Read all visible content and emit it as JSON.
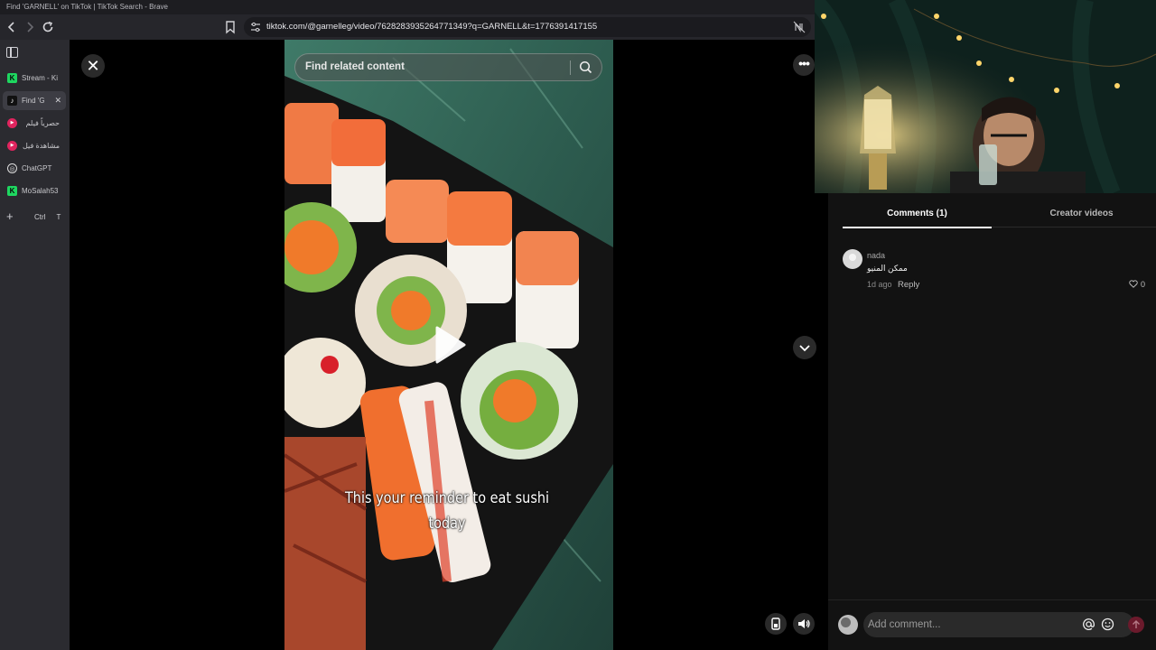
{
  "window": {
    "title": "Find 'GARNELL' on TikTok | TikTok Search - Brave"
  },
  "toolbar": {
    "url": "tiktok.com/@garnelleg/video/7628283935264771349?q=GARNELL&t=1776391417155",
    "back_icon": "arrow-left-icon",
    "forward_icon": "arrow-right-icon",
    "reload_icon": "reload-icon"
  },
  "sidebar": {
    "tabs": [
      {
        "label": "Stream - Ki",
        "favicon": "K",
        "favicon_style": "kick",
        "active": false
      },
      {
        "label": "Find 'G",
        "favicon": "♪",
        "favicon_style": "tiktok",
        "active": true,
        "close": "✕"
      },
      {
        "label": "حصرياً فيلم",
        "favicon": "▶",
        "favicon_style": "red",
        "active": false
      },
      {
        "label": "مشاهدة فيل",
        "favicon": "▶",
        "favicon_style": "red",
        "active": false
      },
      {
        "label": "ChatGPT",
        "favicon": "◎",
        "favicon_style": "gpt",
        "active": false
      },
      {
        "label": "MoSalah53",
        "favicon": "K",
        "favicon_style": "kick",
        "active": false
      }
    ],
    "new_tab": {
      "icon": "+",
      "hint": "Ctrl T"
    }
  },
  "video": {
    "search_placeholder": "Find related content",
    "caption_line1": "This your reminder to eat sushi",
    "caption_line2": "today",
    "close_label": "✕",
    "more_label": "•••"
  },
  "panel": {
    "tabs": [
      {
        "label": "Comments (1)",
        "active": true
      },
      {
        "label": "Creator videos",
        "active": false
      }
    ],
    "comments": [
      {
        "user": "nada",
        "text": "ممكن المنيو",
        "time": "1d ago",
        "reply_label": "Reply",
        "likes": "0"
      }
    ],
    "composer": {
      "placeholder": "Add comment..."
    }
  },
  "colors": {
    "accent_send": "#6b1a2c",
    "panel_bg": "#121212",
    "sidebar_bg": "#2b2b30",
    "kick_green": "#1ed760"
  }
}
